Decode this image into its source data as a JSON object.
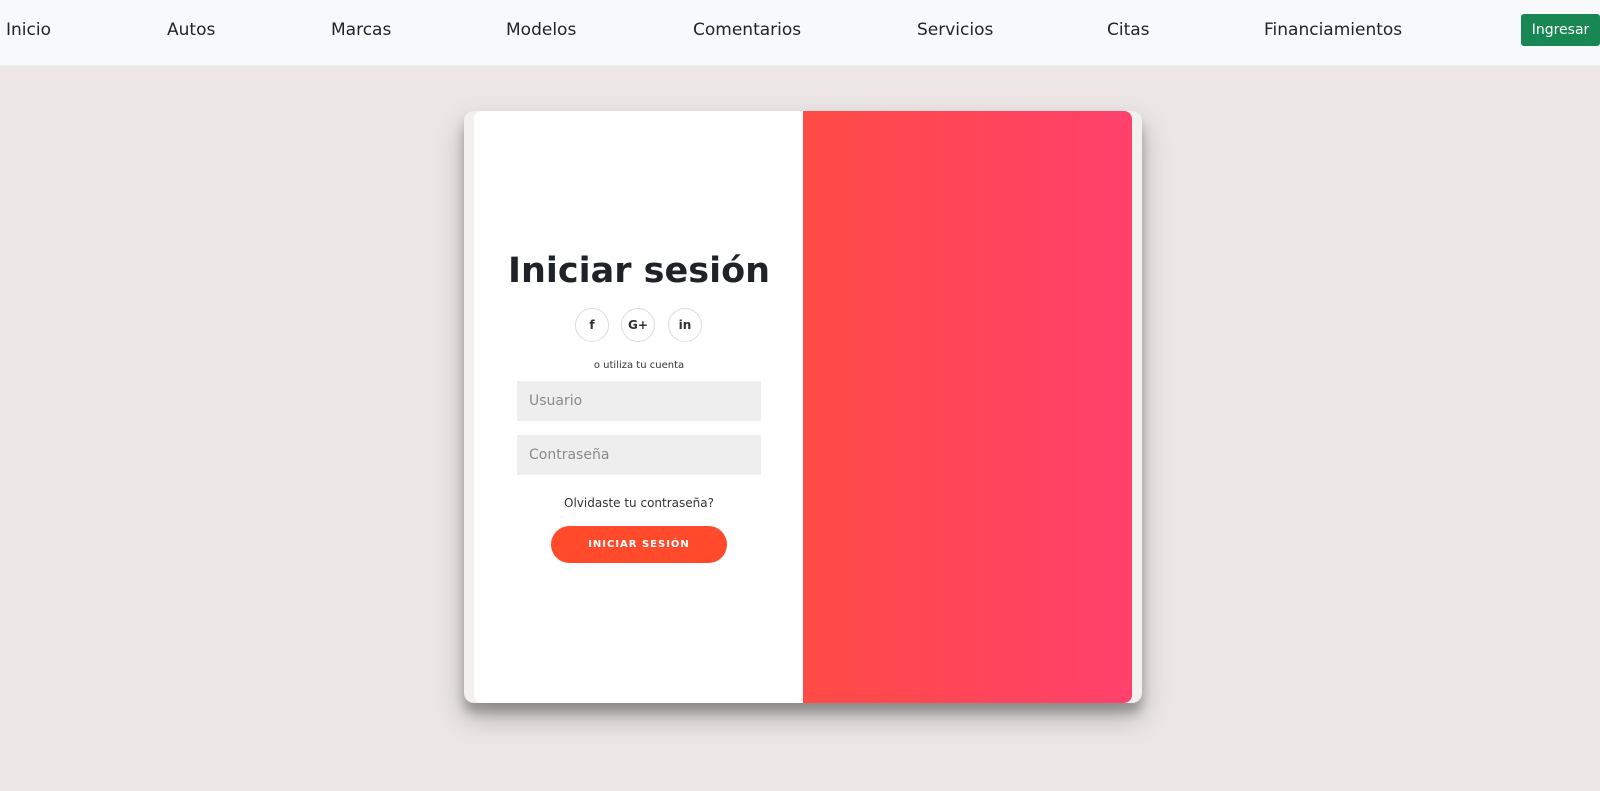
{
  "nav": {
    "links": [
      "Inicio",
      "Autos",
      "Marcas",
      "Modelos",
      "Comentarios",
      "Servicios",
      "Citas",
      "Financiamientos"
    ],
    "login_label": "Ingresar"
  },
  "login": {
    "title": "Iniciar sesión",
    "social": [
      {
        "name": "facebook-icon",
        "glyph": "f"
      },
      {
        "name": "google-plus-icon",
        "glyph": "G+"
      },
      {
        "name": "linkedin-icon",
        "glyph": "in"
      }
    ],
    "hint": "o utiliza tu cuenta",
    "username_placeholder": "Usuario",
    "password_placeholder": "Contraseña",
    "forgot": "Olvidaste tu contraseña?",
    "submit": "INICIAR SESIÓN"
  },
  "colors": {
    "nav_bg": "#f8f9fa",
    "page_bg": "#ece6e6",
    "login_btn": "#198754",
    "overlay_start": "#ff4b45",
    "overlay_end": "#ff416c",
    "submit_btn": "#ff4b2b"
  }
}
